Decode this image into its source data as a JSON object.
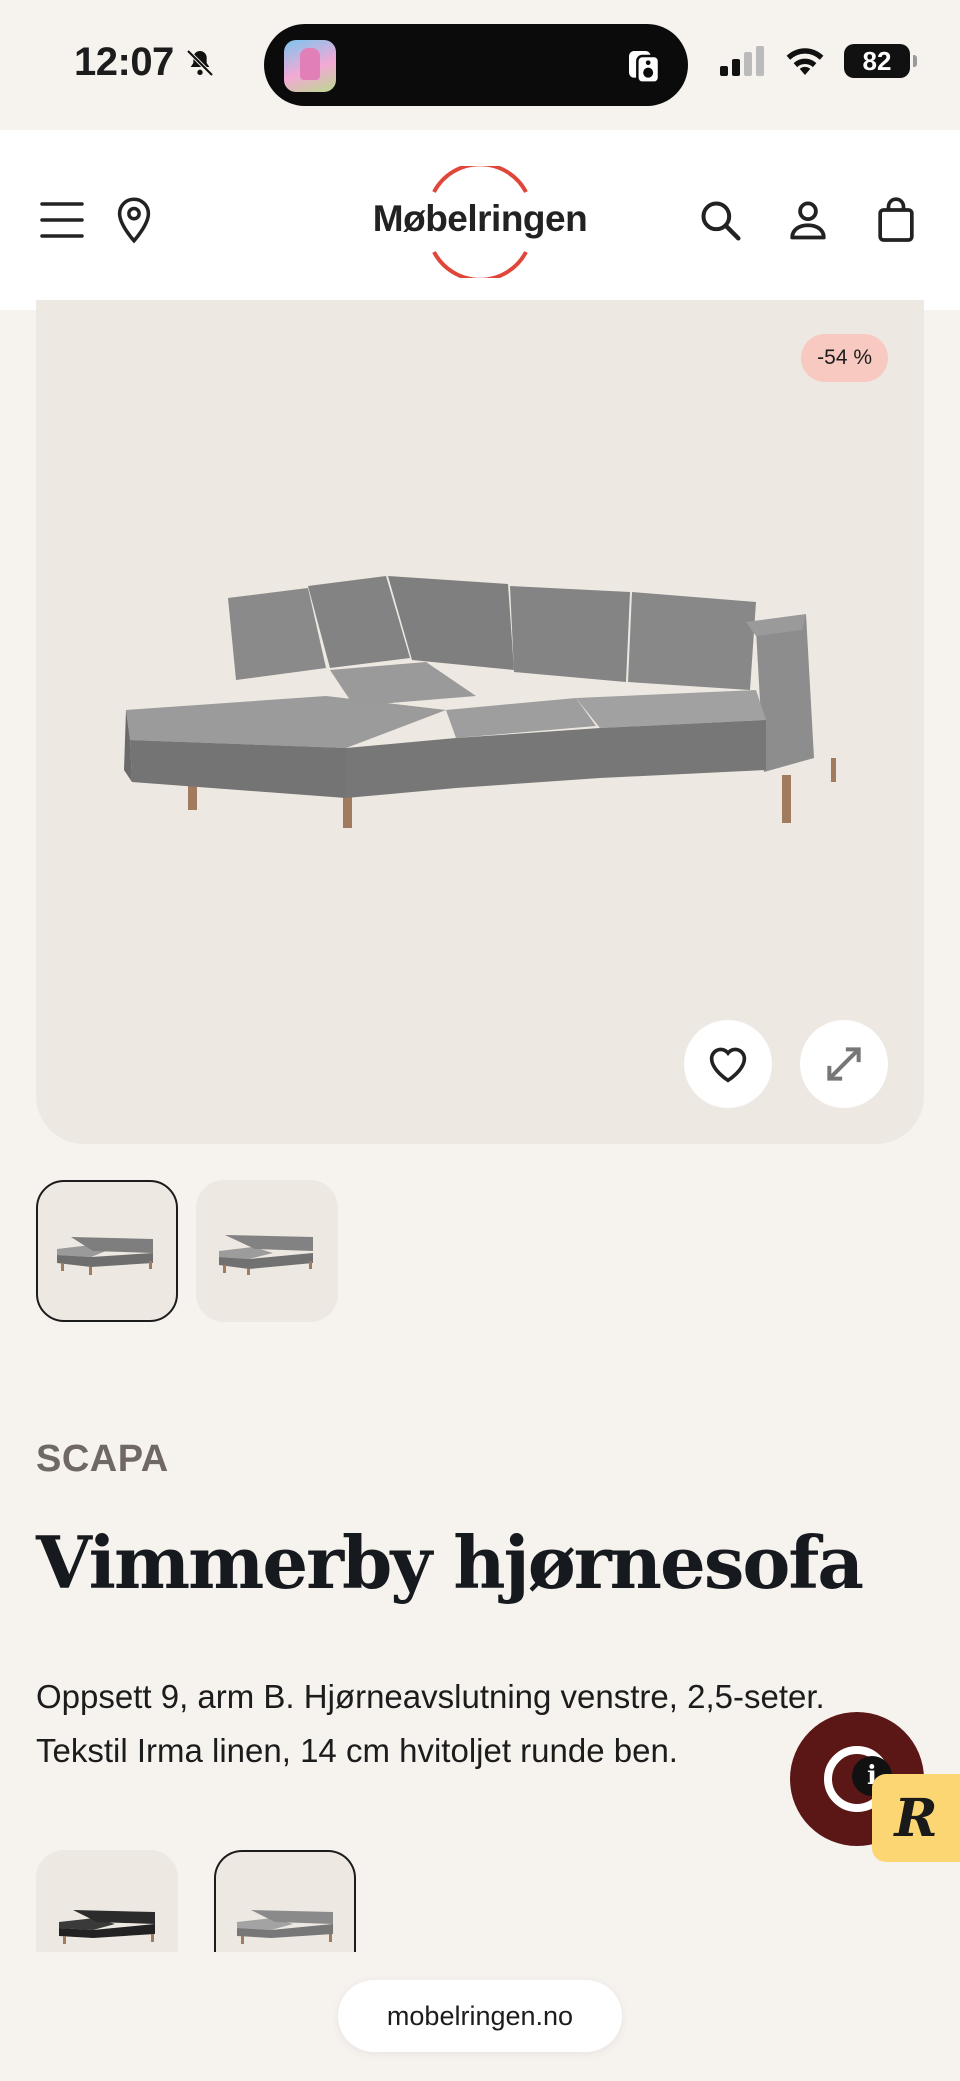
{
  "status_bar": {
    "time": "12:07",
    "battery": "82"
  },
  "header": {
    "logo_text": "Møbelringen"
  },
  "product": {
    "discount_badge": "-54 %",
    "brand": "SCAPA",
    "title": "Vimmerby hjørnesofa",
    "description": "Oppsett 9, arm B. Hjørneavslutning venstre, 2,5-seter. Tekstil Irma linen, 14 cm hvitoljet runde ben."
  },
  "chat": {
    "badge_letter": "R",
    "info_letter": "i"
  },
  "browser": {
    "url": "mobelringen.no"
  },
  "colors": {
    "accent_red": "#e0463a",
    "chat_bg": "#5b1616",
    "badge_yellow": "#fbd672",
    "discount_bg": "#f7c9c1"
  },
  "icons": [
    "bell-slash-icon",
    "menu-icon",
    "location-pin-icon",
    "search-icon",
    "user-icon",
    "cart-icon",
    "heart-icon",
    "expand-icon",
    "chat-icon"
  ]
}
